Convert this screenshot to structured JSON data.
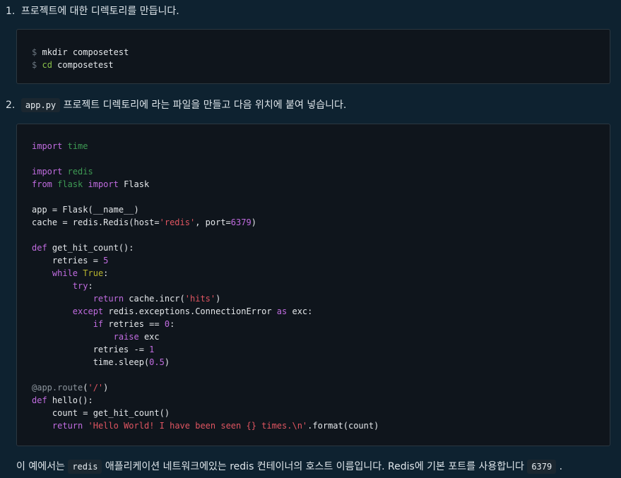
{
  "step1": {
    "number": "1.",
    "text": "프로젝트에 대한 디렉토리를 만듭니다."
  },
  "terminal": {
    "line1": {
      "prompt": "$",
      "cmd": "mkdir composetest"
    },
    "line2": {
      "prompt": "$",
      "cmd": "cd",
      "arg": " composetest"
    }
  },
  "step2": {
    "number": "2.",
    "code_label": "app.py",
    "text": "프로젝트 디렉토리에 라는 파일을 만들고 다음 위치에 붙여 넣습니다."
  },
  "footer": {
    "part1": "이 예에서는 ",
    "code1": "redis",
    "part2": " 애플리케이션 네트워크에있는 redis 컨테이너의 호스트 이름입니다. Redis에 기본 포트를 사용합니다 ",
    "code2": "6379",
    "part3": " ."
  },
  "colors": {
    "background": "#0e2230",
    "code_background": "#0f151c",
    "keyword": "#c16ce0",
    "module": "#3e9b54",
    "string": "#e05561"
  }
}
